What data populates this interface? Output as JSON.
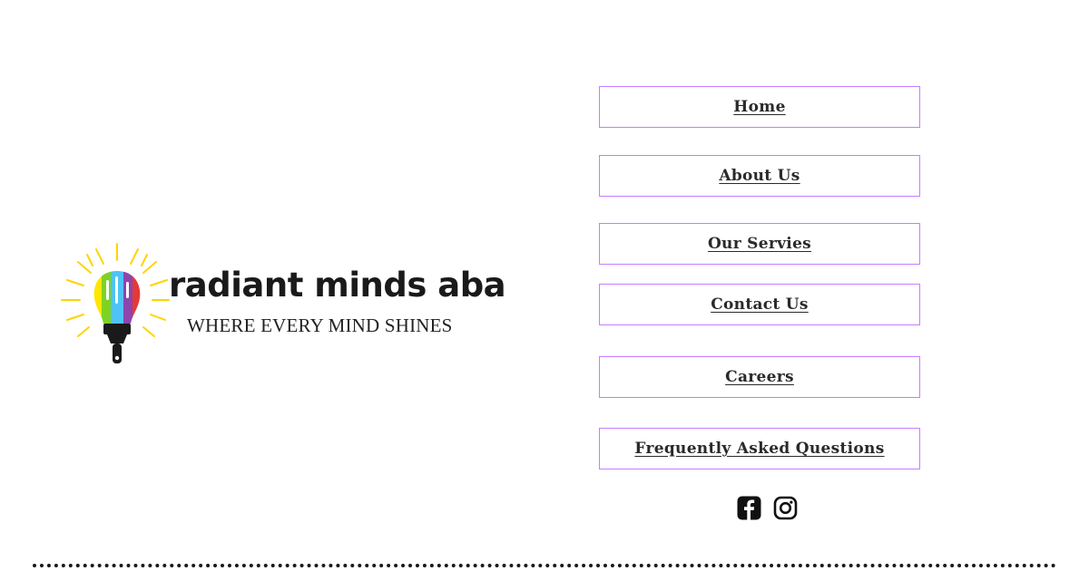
{
  "brand": {
    "name": "radiant minds aba",
    "tagline": "WHERE EVERY MIND SHINES"
  },
  "nav": {
    "items": [
      {
        "label": "Home"
      },
      {
        "label": "About Us"
      },
      {
        "label": "Our Servies"
      },
      {
        "label": "Contact Us"
      },
      {
        "label": "Careers"
      },
      {
        "label": "Frequently Asked Questions"
      }
    ]
  },
  "social": {
    "icons": [
      "facebook-icon",
      "instagram-icon"
    ]
  },
  "colors": {
    "button_border": "#c77dff",
    "text": "#2a2a2a",
    "rays": "#ffd400",
    "bulb_stripes": [
      "#ffe600",
      "#7ed321",
      "#4fc3f7",
      "#8e44ad",
      "#e53935"
    ]
  }
}
